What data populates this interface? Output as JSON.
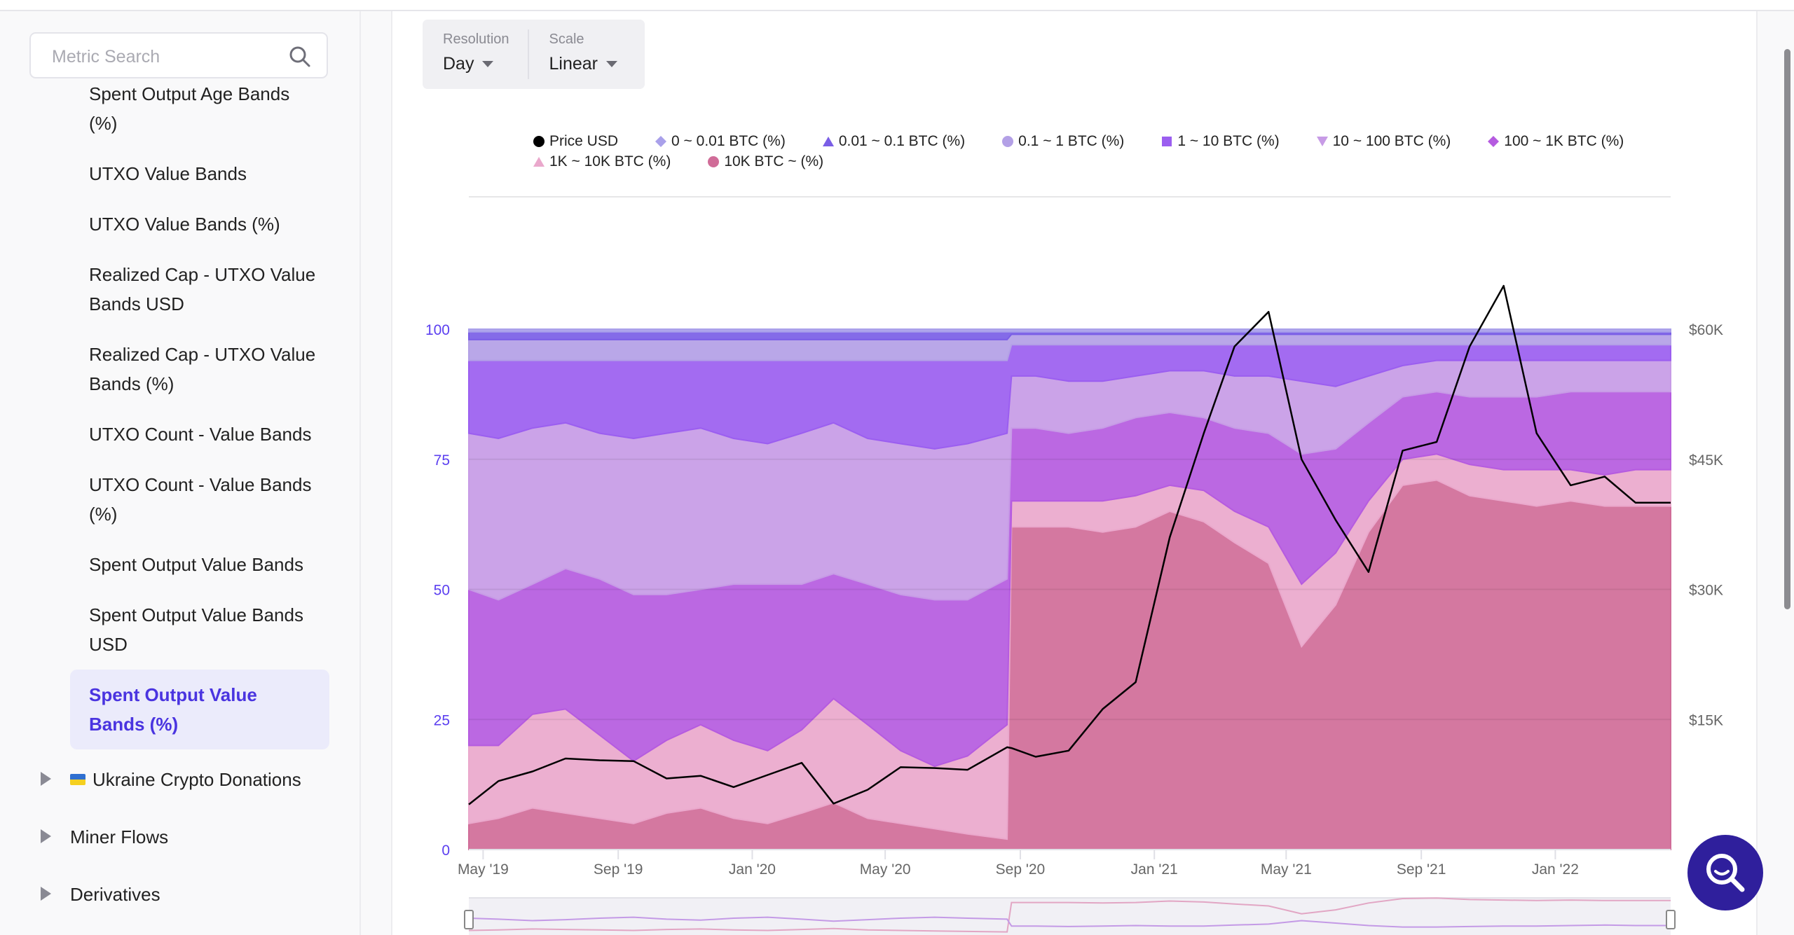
{
  "sidebar": {
    "search_placeholder": "Metric Search",
    "items": [
      {
        "label": "Spent Output Age Bands (%)"
      },
      {
        "label": "UTXO Value Bands"
      },
      {
        "label": "UTXO Value Bands (%)"
      },
      {
        "label": "Realized Cap - UTXO Value Bands USD"
      },
      {
        "label": "Realized Cap - UTXO Value Bands (%)"
      },
      {
        "label": "UTXO Count - Value Bands"
      },
      {
        "label": "UTXO Count - Value Bands (%)"
      },
      {
        "label": "Spent Output Value Bands"
      },
      {
        "label": "Spent Output Value Bands USD"
      },
      {
        "label": "Spent Output Value Bands (%)",
        "selected": true
      }
    ],
    "groups": [
      {
        "label": "Ukraine Crypto Donations",
        "icon": "ukraine-flag"
      },
      {
        "label": "Miner Flows"
      },
      {
        "label": "Derivatives"
      }
    ]
  },
  "toolbar": {
    "resolution_label": "Resolution",
    "resolution_value": "Day",
    "scale_label": "Scale",
    "scale_value": "Linear"
  },
  "colors": {
    "accent": "#4a34e0",
    "fab": "#2f1f9c",
    "left_axis": "#5b3ff0"
  },
  "chart_data": {
    "type": "area",
    "stacked": true,
    "grid": true,
    "legend_placement": "top",
    "x": [
      "2019-04-18",
      "2019-05-15",
      "2019-06-15",
      "2019-07-15",
      "2019-08-15",
      "2019-09-15",
      "2019-10-15",
      "2019-11-15",
      "2019-12-15",
      "2020-01-15",
      "2020-02-15",
      "2020-03-15",
      "2020-04-15",
      "2020-05-15",
      "2020-06-15",
      "2020-07-15",
      "2020-08-20",
      "2020-08-24",
      "2020-09-15",
      "2020-10-15",
      "2020-11-15",
      "2020-12-15",
      "2021-01-15",
      "2021-02-15",
      "2021-03-15",
      "2021-04-15",
      "2021-05-15",
      "2021-06-15",
      "2021-07-15",
      "2021-08-15",
      "2021-09-15",
      "2021-10-15",
      "2021-11-15",
      "2021-12-15",
      "2022-01-15",
      "2022-02-15",
      "2022-03-15",
      "2022-04-16"
    ],
    "x_ticks": [
      {
        "label": "May '19",
        "date": "2019-05-01"
      },
      {
        "label": "Sep '19",
        "date": "2019-09-01"
      },
      {
        "label": "Jan '20",
        "date": "2020-01-01"
      },
      {
        "label": "May '20",
        "date": "2020-05-01"
      },
      {
        "label": "Sep '20",
        "date": "2020-09-01"
      },
      {
        "label": "Jan '21",
        "date": "2021-01-01"
      },
      {
        "label": "May '21",
        "date": "2021-05-01"
      },
      {
        "label": "Sep '21",
        "date": "2021-09-01"
      },
      {
        "label": "Jan '22",
        "date": "2022-01-01"
      }
    ],
    "y_left": {
      "ylim": [
        0,
        100
      ],
      "ticks": [
        {
          "v": 0,
          "label": "0"
        },
        {
          "v": 25,
          "label": "25"
        },
        {
          "v": 50,
          "label": "50"
        },
        {
          "v": 75,
          "label": "75"
        },
        {
          "v": 100,
          "label": "100"
        }
      ]
    },
    "y_right": {
      "ylim": [
        0,
        60000
      ],
      "ticks": [
        {
          "v": 15000,
          "label": "$15K"
        },
        {
          "v": 30000,
          "label": "$30K"
        },
        {
          "v": 45000,
          "label": "$45K"
        },
        {
          "v": 60000,
          "label": "$60K"
        }
      ]
    },
    "price": {
      "name": "Price USD",
      "color": "#000000",
      "marker": "circle",
      "values": [
        5200,
        7900,
        9000,
        10500,
        10300,
        10200,
        8200,
        8500,
        7200,
        8600,
        10000,
        5300,
        6900,
        9500,
        9400,
        9200,
        11800,
        11700,
        10700,
        11400,
        16200,
        19300,
        36000,
        48000,
        58000,
        62000,
        45000,
        38000,
        32000,
        46000,
        47000,
        58000,
        65000,
        48000,
        42000,
        43000,
        40000,
        40000
      ]
    },
    "series": [
      {
        "name": "10K BTC ~ (%)",
        "color": "#d06c98",
        "marker": "circle",
        "values": [
          5,
          6,
          8,
          7,
          6,
          5,
          7,
          8,
          6,
          5,
          7,
          9,
          6,
          5,
          4,
          3,
          2,
          62,
          62,
          62,
          61,
          62,
          65,
          63,
          59,
          55,
          39,
          47,
          61,
          70,
          71,
          68,
          67,
          66,
          67,
          66,
          66,
          66
        ]
      },
      {
        "name": "1K ~ 10K BTC (%)",
        "color": "#eaa8cc",
        "marker": "triangle",
        "values": [
          15,
          14,
          18,
          20,
          16,
          12,
          14,
          16,
          15,
          14,
          16,
          20,
          18,
          14,
          12,
          15,
          22,
          5,
          5,
          5,
          6,
          6,
          5,
          6,
          6,
          7,
          12,
          10,
          6,
          5,
          5,
          6,
          6,
          7,
          6,
          6,
          7,
          7
        ]
      },
      {
        "name": "100 ~ 1K BTC (%)",
        "color": "#b55be0",
        "marker": "diamond",
        "values": [
          30,
          28,
          25,
          27,
          30,
          32,
          28,
          26,
          30,
          32,
          28,
          24,
          27,
          30,
          32,
          30,
          28,
          14,
          14,
          13,
          14,
          15,
          14,
          14,
          16,
          18,
          25,
          20,
          15,
          12,
          12,
          13,
          14,
          14,
          15,
          16,
          15,
          15
        ]
      },
      {
        "name": "10 ~ 100 BTC (%)",
        "color": "#c79be6",
        "marker": "triangle-down",
        "values": [
          30,
          31,
          30,
          28,
          28,
          30,
          31,
          31,
          28,
          27,
          29,
          29,
          28,
          29,
          29,
          30,
          28,
          10,
          10,
          10,
          9,
          8,
          8,
          9,
          10,
          11,
          14,
          12,
          9,
          6,
          6,
          7,
          7,
          7,
          6,
          6,
          6,
          6
        ]
      },
      {
        "name": "1 ~ 10 BTC (%)",
        "color": "#9b5ef0",
        "marker": "square",
        "values": [
          14,
          15,
          13,
          12,
          14,
          15,
          14,
          13,
          15,
          16,
          14,
          12,
          15,
          16,
          17,
          16,
          14,
          6,
          6,
          7,
          7,
          6,
          5,
          5,
          6,
          6,
          7,
          8,
          6,
          4,
          3,
          3,
          3,
          3,
          3,
          3,
          3,
          3
        ]
      },
      {
        "name": "0.1 ~ 1 BTC (%)",
        "color": "#b3a0e6",
        "marker": "circle",
        "values": [
          4,
          4,
          4,
          4,
          4,
          4,
          4,
          4,
          4,
          4,
          4,
          4,
          4,
          4,
          4,
          4,
          4,
          2,
          2,
          2,
          2,
          2,
          2,
          2,
          2,
          2,
          2,
          2,
          2,
          2,
          2,
          2,
          2,
          2,
          2,
          2,
          2,
          2
        ]
      },
      {
        "name": "0.01 ~ 0.1 BTC (%)",
        "color": "#7a5ee6",
        "marker": "triangle",
        "values": [
          1.5,
          1.5,
          1.5,
          1.5,
          1.5,
          1.5,
          1.5,
          1.5,
          1.5,
          1.5,
          1.5,
          1.5,
          1.5,
          1.5,
          1.5,
          1.5,
          1.5,
          0.5,
          0.5,
          0.5,
          0.5,
          0.5,
          0.5,
          0.5,
          0.5,
          0.5,
          0.5,
          0.5,
          0.5,
          0.5,
          0.5,
          0.5,
          0.5,
          0.5,
          0.5,
          0.5,
          0.5,
          0.5
        ]
      },
      {
        "name": "0 ~ 0.01 BTC (%)",
        "color": "#a9a0ea",
        "marker": "diamond",
        "values": [
          0.5,
          0.5,
          0.5,
          0.5,
          0.5,
          0.5,
          0.5,
          0.5,
          0.5,
          0.5,
          0.5,
          0.5,
          0.5,
          0.5,
          0.5,
          0.5,
          0.5,
          0.5,
          0.5,
          0.5,
          0.5,
          0.5,
          0.5,
          0.5,
          0.5,
          0.5,
          0.5,
          0.5,
          0.5,
          0.5,
          0.5,
          0.5,
          0.5,
          0.5,
          0.5,
          0.5,
          0.5,
          0.5
        ]
      }
    ],
    "legend_order": [
      "Price USD",
      "0 ~ 0.01 BTC (%)",
      "0.01 ~ 0.1 BTC (%)",
      "0.1 ~ 1 BTC (%)",
      "1 ~ 10 BTC (%)",
      "10 ~ 100 BTC (%)",
      "100 ~ 1K BTC (%)",
      "1K ~ 10K BTC (%)",
      "10K BTC ~ (%)"
    ]
  }
}
